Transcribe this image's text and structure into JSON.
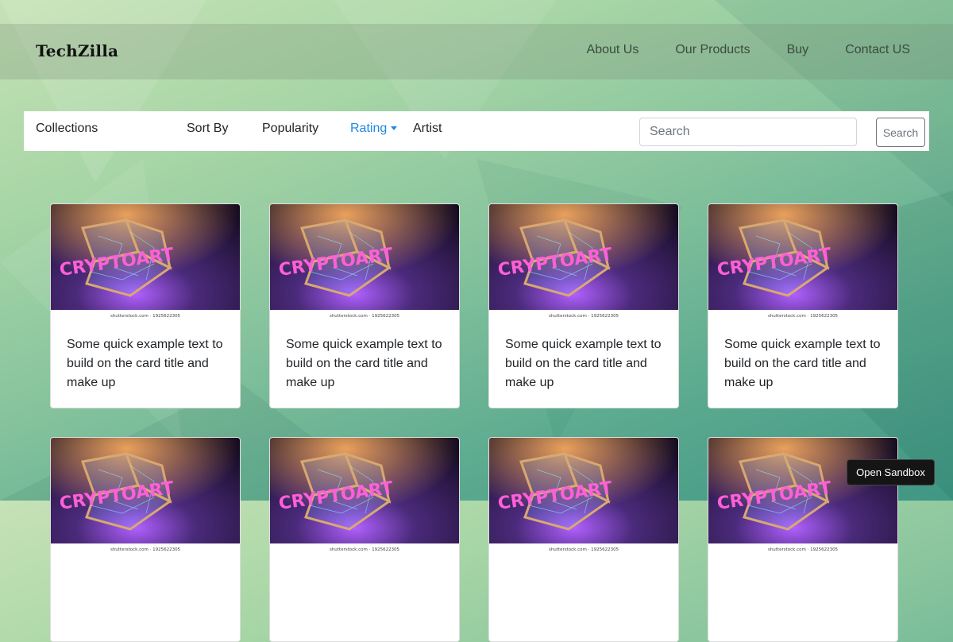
{
  "header": {
    "brand": "TechZilla",
    "nav": [
      "About Us",
      "Our Products",
      "Buy",
      "Contact US"
    ]
  },
  "filters": {
    "collections": "Collections",
    "sort_by": "Sort By",
    "popularity": "Popularity",
    "rating": "Rating",
    "artist": "Artist",
    "search_placeholder": "Search",
    "search_button": "Search"
  },
  "cards": [
    {
      "image_word": "CRYPTOART",
      "caption": "shutterstock.com · 1925622305",
      "text": "Some quick example text to build on the card title and make up"
    },
    {
      "image_word": "CRYPTOART",
      "caption": "shutterstock.com · 1925622305",
      "text": "Some quick example text to build on the card title and make up"
    },
    {
      "image_word": "CRYPTOART",
      "caption": "shutterstock.com · 1925622305",
      "text": "Some quick example text to build on the card title and make up"
    },
    {
      "image_word": "CRYPTOART",
      "caption": "shutterstock.com · 1925622305",
      "text": "Some quick example text to build on the card title and make up"
    },
    {
      "image_word": "CRYPTOART",
      "caption": "shutterstock.com · 1925622305",
      "text": ""
    },
    {
      "image_word": "CRYPTOART",
      "caption": "shutterstock.com · 1925622305",
      "text": ""
    },
    {
      "image_word": "CRYPTOART",
      "caption": "shutterstock.com · 1925622305",
      "text": ""
    },
    {
      "image_word": "CRYPTOART",
      "caption": "shutterstock.com · 1925622305",
      "text": ""
    }
  ],
  "sandbox_button": "Open Sandbox",
  "colors": {
    "accent": "#1e88e5",
    "card_bg": "#ffffff",
    "dark_button": "#151515"
  }
}
